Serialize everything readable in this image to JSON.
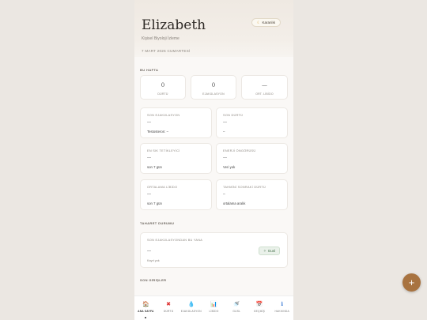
{
  "header": {
    "name": "Elizabeth",
    "subtitle": "Kişisel Biyoloji İzleme",
    "date": "7 MART 2026 CUMARTESİ",
    "theme_button": "Karanlık",
    "theme_icon": "moon-icon"
  },
  "this_week": {
    "label": "BU HAFTA",
    "stats": [
      {
        "value": "0",
        "label": "DÜRTÜ"
      },
      {
        "value": "0",
        "label": "EJAKÜLASYON"
      },
      {
        "value": "—",
        "label": "ORT. LİBİDO"
      }
    ]
  },
  "cards": [
    {
      "title": "SON EJAKÜLASYON",
      "value": "—",
      "sub": "Testosteron: –"
    },
    {
      "title": "SON DÜRTÜ",
      "value": "—",
      "sub": "–"
    },
    {
      "title": "EN SIK TETİKLEYİCİ",
      "value": "—",
      "sub": "son 7 gün"
    },
    {
      "title": "ENERJİ ÖNGÖRÜSÜ",
      "value": "—",
      "sub": "Veri yok"
    },
    {
      "title": "ORTALAMA LİBİDO",
      "value": "—",
      "sub": "son 7 gün"
    },
    {
      "title": "TAHMİNİ SONRAKİ DÜRTÜ",
      "value": "–",
      "sub": "ortalama aralık"
    }
  ],
  "taharet": {
    "label": "TAHARET DURUMU",
    "card_title": "SON EJAKÜLASYONDAN BU YANA",
    "value": "—",
    "sub": "Kayıt yok",
    "button": "Gusl"
  },
  "recent": {
    "label": "SON GİRİŞLER"
  },
  "fab": "+",
  "nav": [
    {
      "label": "ANA SAYFA",
      "icon": "🏠",
      "icon_name": "home-icon",
      "active": true
    },
    {
      "label": "DÜRTÜ",
      "icon": "✖",
      "icon_name": "urge-icon"
    },
    {
      "label": "EJAKÜLASYON",
      "icon": "💧",
      "icon_name": "droplet-icon"
    },
    {
      "label": "LİBİDO",
      "icon": "📊",
      "icon_name": "chart-icon"
    },
    {
      "label": "GUSL",
      "icon": "🚿",
      "icon_name": "shower-icon"
    },
    {
      "label": "GEÇMİŞ",
      "icon": "📅",
      "icon_name": "calendar-icon"
    },
    {
      "label": "HAKKINDA",
      "icon": "ℹ",
      "icon_name": "info-icon"
    }
  ],
  "colors": {
    "accent": "#a87340",
    "gusl": "#3f6b45"
  }
}
